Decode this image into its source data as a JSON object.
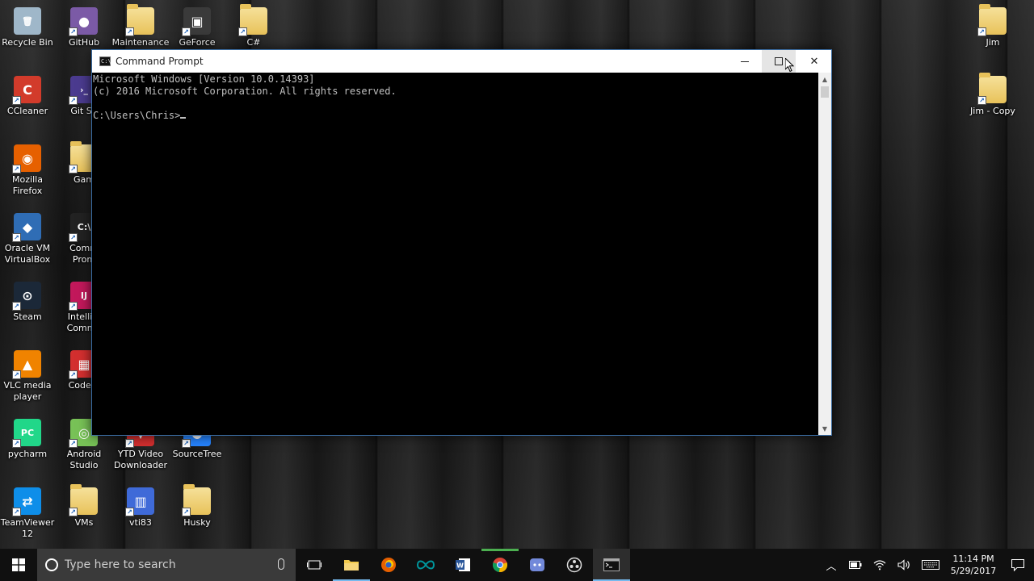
{
  "desktop": {
    "icons": [
      {
        "label": "Recycle Bin",
        "icon": "recycle-bin-icon",
        "color": "#9fb7c9"
      },
      {
        "label": "GitHub",
        "icon": "github-icon",
        "color": "#7b5aa6"
      },
      {
        "label": "Maintenance",
        "icon": "folder-icon",
        "color": "#e8c25a"
      },
      {
        "label": "GeForce",
        "icon": "geforce-icon",
        "color": "#3a3a3a"
      },
      {
        "label": "C#",
        "icon": "folder-icon",
        "color": "#e8c25a"
      },
      {
        "label": "CCleaner",
        "icon": "ccleaner-icon",
        "color": "#d23b2b"
      },
      {
        "label": "Git Sh",
        "icon": "git-shell-icon",
        "color": "#4b3b8f"
      },
      {
        "label": "Mozilla\nFirefox",
        "icon": "firefox-icon",
        "color": "#e66000"
      },
      {
        "label": "Gam",
        "icon": "folder-icon",
        "color": "#e8c25a"
      },
      {
        "label": "Oracle VM\nVirtualBox",
        "icon": "virtualbox-icon",
        "color": "#2f6db5"
      },
      {
        "label": "Comm\nProm",
        "icon": "command-prompt-icon",
        "color": "#222222"
      },
      {
        "label": "Steam",
        "icon": "steam-icon",
        "color": "#1b2838"
      },
      {
        "label": "IntelliJ I\nCommu",
        "icon": "intellij-icon",
        "color": "#c2185b"
      },
      {
        "label": "VLC media\nplayer",
        "icon": "vlc-icon",
        "color": "#f08300"
      },
      {
        "label": "CodeBl",
        "icon": "codeblocks-icon",
        "color": "#d32f2f"
      },
      {
        "label": "pycharm",
        "icon": "pycharm-icon",
        "color": "#21d789"
      },
      {
        "label": "Android\nStudio",
        "icon": "android-studio-icon",
        "color": "#78c257"
      },
      {
        "label": "YTD Video\nDownloader",
        "icon": "ytd-icon",
        "color": "#d32f2f"
      },
      {
        "label": "SourceTree",
        "icon": "sourcetree-icon",
        "color": "#2684ff"
      },
      {
        "label": "TeamViewer\n12",
        "icon": "teamviewer-icon",
        "color": "#0e8ee9"
      },
      {
        "label": "VMs",
        "icon": "folder-icon",
        "color": "#e8c25a"
      },
      {
        "label": "vti83",
        "icon": "vti83-icon",
        "color": "#3f6ad8"
      },
      {
        "label": "Husky",
        "icon": "folder-icon",
        "color": "#e8c25a"
      },
      {
        "label": "Jim",
        "icon": "folder-icon",
        "color": "#e8c25a"
      },
      {
        "label": "Jim - Copy",
        "icon": "folder-icon",
        "color": "#e8c25a"
      }
    ]
  },
  "window": {
    "title": "Command Prompt",
    "console_lines": [
      "Microsoft Windows [Version 10.0.14393]",
      "(c) 2016 Microsoft Corporation. All rights reserved.",
      "",
      "C:\\Users\\Chris>"
    ],
    "minimize_symbol": "—",
    "close_symbol": "✕"
  },
  "taskbar": {
    "search_placeholder": "Type here to search",
    "apps": [
      {
        "name": "task-view",
        "icon": "task-view-icon"
      },
      {
        "name": "file-explorer",
        "icon": "folder-icon"
      },
      {
        "name": "firefox",
        "icon": "firefox-icon"
      },
      {
        "name": "arduino",
        "icon": "infinity-icon"
      },
      {
        "name": "word",
        "icon": "word-icon"
      },
      {
        "name": "chrome",
        "icon": "chrome-icon"
      },
      {
        "name": "discord",
        "icon": "discord-icon"
      },
      {
        "name": "obs",
        "icon": "obs-icon"
      },
      {
        "name": "command-prompt",
        "icon": "command-prompt-icon"
      }
    ],
    "time": "11:14 PM",
    "date": "5/29/2017"
  },
  "colors": {
    "console_text": "#c0c0c0",
    "taskbar_bg": "#101010",
    "accent": "#76b9ed"
  }
}
